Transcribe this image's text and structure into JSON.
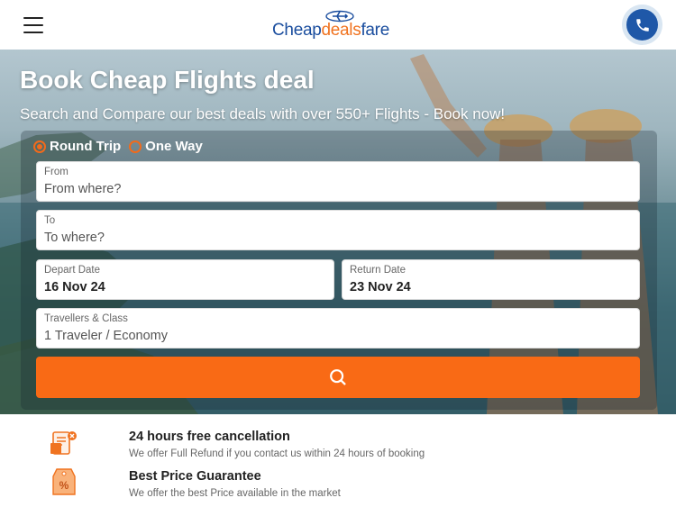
{
  "header": {
    "logo": {
      "part1": "Cheap",
      "part2": "deals",
      "part3": "fare"
    },
    "menu_icon": "hamburger-icon",
    "phone_icon": "phone-icon"
  },
  "hero": {
    "title": "Book Cheap Flights deal",
    "subtitle": "Search and Compare our best deals with over 550+ Flights - Book now!"
  },
  "search_form": {
    "trip_types": [
      {
        "label": "Round Trip",
        "selected": true
      },
      {
        "label": "One Way",
        "selected": false
      }
    ],
    "from": {
      "label": "From",
      "placeholder": "From where?"
    },
    "to": {
      "label": "To",
      "placeholder": "To where?"
    },
    "depart": {
      "label": "Depart Date",
      "value": "16 Nov 24"
    },
    "return": {
      "label": "Return Date",
      "value": "23 Nov 24"
    },
    "travellers": {
      "label": "Travellers & Class",
      "value": "1 Traveler / Economy"
    },
    "search_icon": "search-icon"
  },
  "features": [
    {
      "title": "24 hours free cancellation",
      "description": "We offer Full Refund if you contact us within 24 hours of booking",
      "icon": "cancellation-icon"
    },
    {
      "title": "Best Price Guarantee",
      "description": "We offer the best Price available in the market",
      "icon": "price-tag-icon"
    }
  ],
  "colors": {
    "accent": "#f96a15",
    "brand_blue": "#1f58a8"
  }
}
